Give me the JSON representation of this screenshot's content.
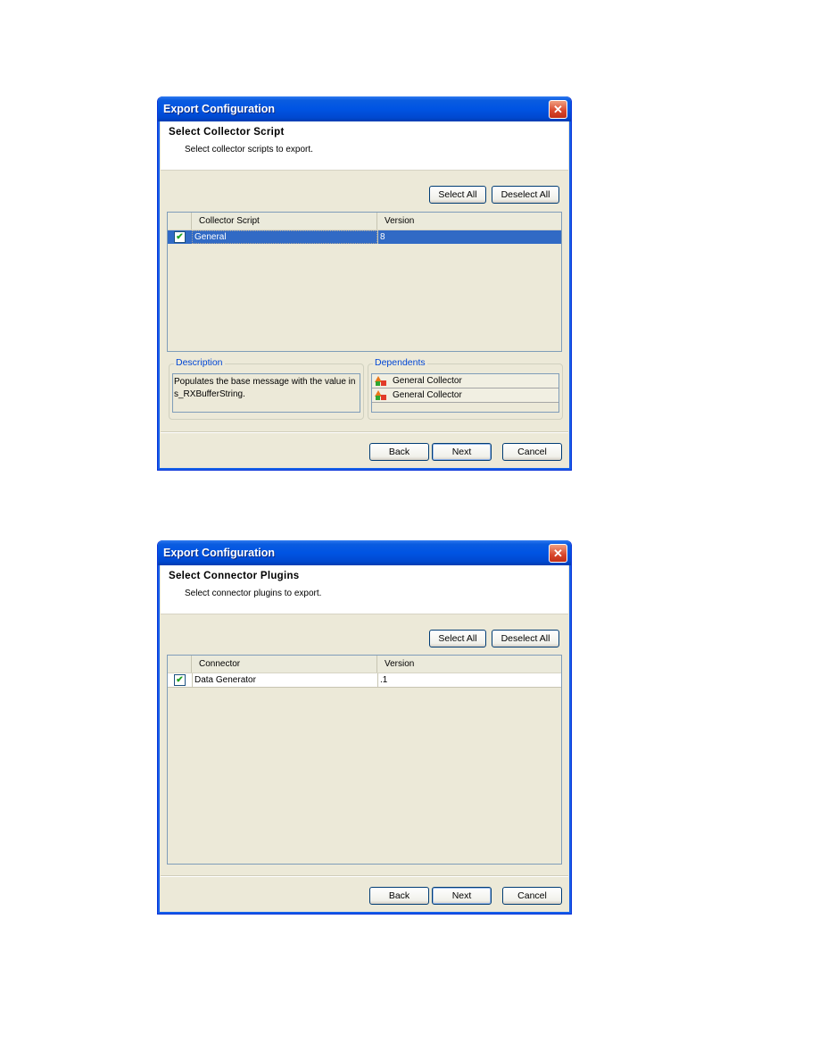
{
  "dialogs": [
    {
      "title": "Export Configuration",
      "close_icon": "close-icon",
      "header": {
        "title": "Select Collector Script",
        "subtitle": "Select collector scripts to export."
      },
      "buttons": {
        "select_all": "Select All",
        "deselect_all": "Deselect All",
        "back": "Back",
        "next": "Next",
        "cancel": "Cancel"
      },
      "table": {
        "columns": [
          "",
          "Collector Script",
          "Version"
        ],
        "rows": [
          {
            "checked": true,
            "name": "General",
            "version": "8",
            "selected": true
          }
        ]
      },
      "description": {
        "label": "Description",
        "text": "Populates the base message with the value in s_RXBufferString."
      },
      "dependents": {
        "label": "Dependents",
        "items": [
          "General Collector",
          "General Collector"
        ]
      }
    },
    {
      "title": "Export Configuration",
      "close_icon": "close-icon",
      "header": {
        "title": "Select Connector Plugins",
        "subtitle": "Select connector plugins to export."
      },
      "buttons": {
        "select_all": "Select All",
        "deselect_all": "Deselect All",
        "back": "Back",
        "next": "Next",
        "cancel": "Cancel"
      },
      "table": {
        "columns": [
          "",
          "Connector",
          "Version"
        ],
        "rows": [
          {
            "checked": true,
            "name": "Data Generator",
            "version": ".1",
            "selected": false
          }
        ]
      }
    }
  ],
  "glyphs": {
    "close": "✕",
    "check": "✔"
  }
}
